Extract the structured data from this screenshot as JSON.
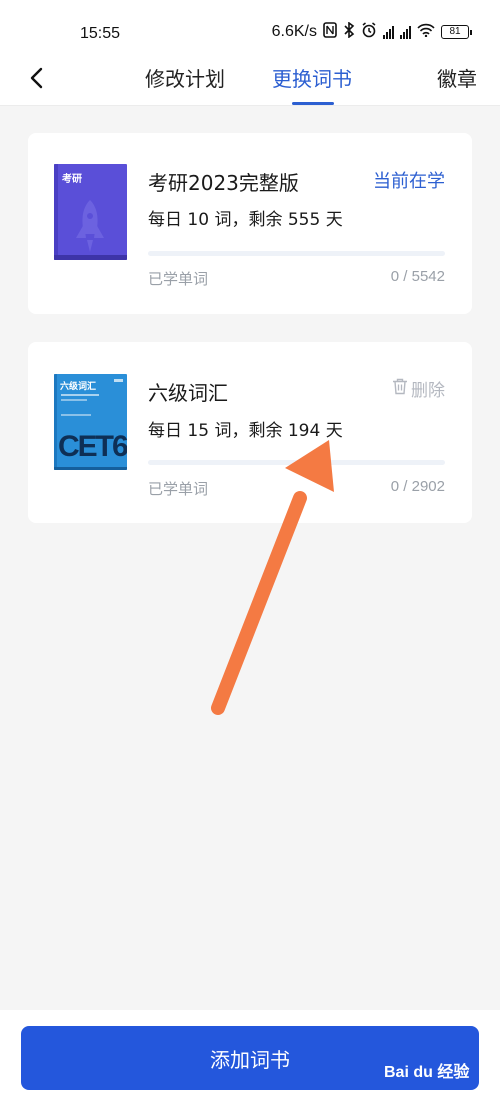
{
  "status_bar": {
    "time": "15:55",
    "net_speed": "6.6K/s",
    "battery": "81",
    "icons": [
      "nfc-icon",
      "bluetooth-icon",
      "alarm-icon",
      "hd-signal-icon",
      "hd-signal-icon",
      "wifi-icon",
      "battery-icon"
    ]
  },
  "nav": {
    "back_icon": "chevron-left-icon",
    "tabs": [
      {
        "label": "修改计划",
        "active": false
      },
      {
        "label": "更换词书",
        "active": true
      },
      {
        "label": "徽章",
        "active": false
      }
    ]
  },
  "books": [
    {
      "cover_text": "考研",
      "title": "考研2023完整版",
      "plan": "每日 10 词，剩余 555 天",
      "status": "当前在学",
      "learned_label": "已学单词",
      "learned_count": "0 / 5542",
      "progress": 0
    },
    {
      "cover_text": "六级词汇",
      "cover_big_text": "CET6",
      "title": "六级词汇",
      "plan": "每日 15 词，剩余 194 天",
      "action": "删除",
      "action_icon": "trash-icon",
      "learned_label": "已学单词",
      "learned_count": "0 / 2902",
      "progress": 0
    }
  ],
  "add_button": "添加词书",
  "watermark": "Bai du 经验",
  "colors": {
    "accent": "#2c5fd1",
    "button": "#2457dc",
    "cover_kaoyan": "#5a4fd8",
    "cover_cet6": "#2a8fd8",
    "annotation_arrow": "#f47a43"
  }
}
